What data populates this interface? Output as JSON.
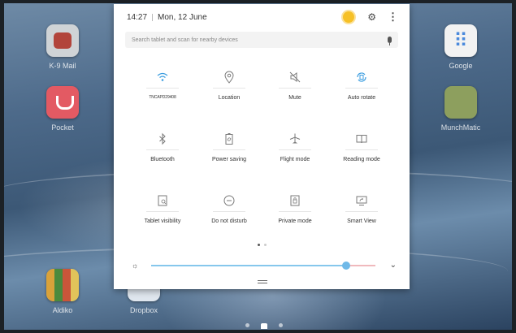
{
  "status_bar": {
    "time": "14:27",
    "date": "Mon, 12 June"
  },
  "search": {
    "placeholder": "Search tablet and scan for nearby devices"
  },
  "tiles": [
    {
      "label": "TNCAPD29408",
      "icon": "wifi-icon",
      "active": true
    },
    {
      "label": "Location",
      "icon": "location-icon",
      "active": false
    },
    {
      "label": "Mute",
      "icon": "mute-icon",
      "active": false
    },
    {
      "label": "Auto rotate",
      "icon": "auto-rotate-icon",
      "active": true
    },
    {
      "label": "Bluetooth",
      "icon": "bluetooth-icon",
      "active": false
    },
    {
      "label": "Power saving",
      "icon": "power-saving-icon",
      "active": false
    },
    {
      "label": "Flight mode",
      "icon": "airplane-icon",
      "active": false
    },
    {
      "label": "Reading mode",
      "icon": "book-icon",
      "active": false
    },
    {
      "label": "Tablet visibility",
      "icon": "tablet-visibility-icon",
      "active": false
    },
    {
      "label": "Do not disturb",
      "icon": "do-not-disturb-icon",
      "active": false
    },
    {
      "label": "Private mode",
      "icon": "private-mode-icon",
      "active": false
    },
    {
      "label": "Smart View",
      "icon": "smart-view-icon",
      "active": false
    }
  ],
  "pager": {
    "pages": 2,
    "current": 1
  },
  "brightness": {
    "level": 0.87
  },
  "home_apps": [
    "K-9 Mail",
    "Pocket",
    "Aldiko",
    "Dropbox",
    "Google",
    "MunchMatic"
  ],
  "colors": {
    "active_icon": "#3d9ee0",
    "inactive_icon": "#7a7a7a",
    "slider_fill": "#86c7ec",
    "slider_thumb": "#6fb9e8",
    "slider_rest": "#f0b9bd"
  }
}
